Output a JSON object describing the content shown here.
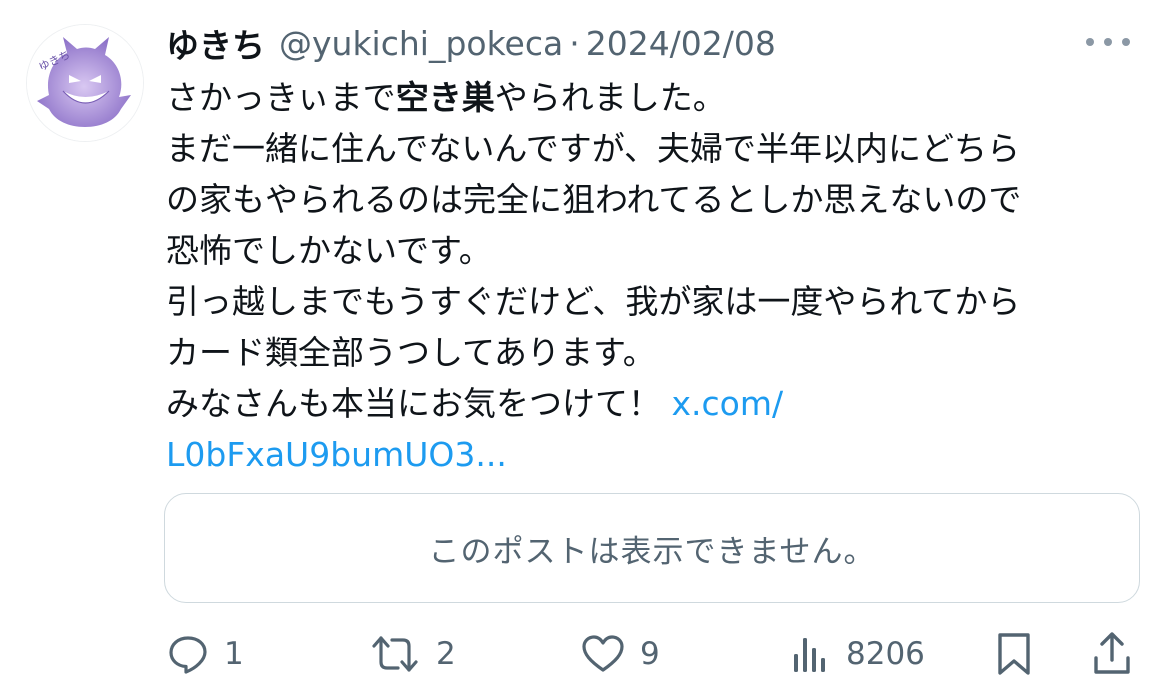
{
  "tweet": {
    "display_name": "ゆきち",
    "handle": "@yukichi_pokeca",
    "separator": "·",
    "date": "2024/02/08",
    "text_lines": {
      "l1_pre": "さかっきぃまで",
      "l1_bold": "空き巣",
      "l1_post": "やられました。",
      "l2": "まだ一緒に住んでないんですが、夫婦で半年以内にどちら",
      "l3": "の家もやられるのは完全に狙われてるとしか思えないので",
      "l4": "恐怖でしかないです。",
      "l5": "引っ越しまでもうすぐだけど、我が家は一度やられてから",
      "l6": "カード類全部うつしてあります。",
      "l7": "みなさんも本当にお気をつけて！ ",
      "link_part1": "x.com/",
      "link_part2": "L0bFxaU9bumUO3..."
    },
    "quote_unavailable": "このポストは表示できません。"
  },
  "actions": {
    "replies": "1",
    "reposts": "2",
    "likes": "9",
    "views": "8206"
  },
  "icons": {
    "avatar": "gengar-avatar",
    "more": "more-horizontal-icon",
    "reply": "reply-icon",
    "repost": "repost-icon",
    "like": "heart-icon",
    "views": "views-chart-icon",
    "bookmark": "bookmark-icon",
    "share": "share-icon"
  },
  "colors": {
    "link": "#1d9bf0",
    "muted": "#536471",
    "text": "#0f1419",
    "border": "#cfd9de"
  }
}
